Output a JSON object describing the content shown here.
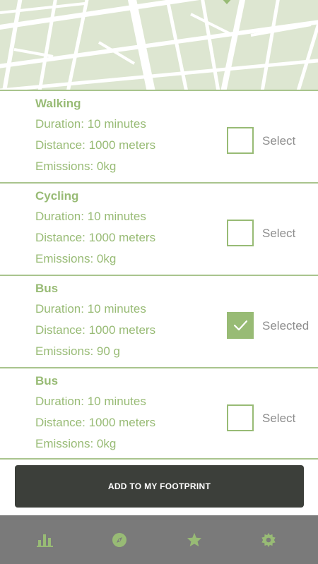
{
  "colors": {
    "accent": "#98bb75",
    "divider": "#a9c48d",
    "map_bg": "#dde6d1",
    "cta_bg": "#3c3f3a",
    "tabbar_bg": "#7a7a7a",
    "select_text": "#8d8d8d"
  },
  "options": [
    {
      "title": "Walking",
      "duration": "Duration: 10 minutes",
      "distance": "Distance: 1000 meters",
      "emissions": "Emissions: 0kg",
      "select_label": "Select",
      "selected": false
    },
    {
      "title": "Cycling",
      "duration": "Duration: 10 minutes",
      "distance": "Distance: 1000 meters",
      "emissions": "Emissions: 0kg",
      "select_label": "Select",
      "selected": false
    },
    {
      "title": "Bus",
      "duration": "Duration: 10 minutes",
      "distance": "Distance: 1000 meters",
      "emissions": "Emissions: 90 g",
      "select_label": "Selected",
      "selected": true
    },
    {
      "title": "Bus",
      "duration": "Duration: 10 minutes",
      "distance": "Distance: 1000 meters",
      "emissions": "Emissions: 0kg",
      "select_label": "Select",
      "selected": false
    }
  ],
  "cta": {
    "label": "ADD TO MY FOOTPRINT"
  },
  "tabbar": {
    "items": [
      {
        "icon": "bar-chart-icon"
      },
      {
        "icon": "compass-icon"
      },
      {
        "icon": "star-icon"
      },
      {
        "icon": "gear-icon"
      }
    ]
  }
}
